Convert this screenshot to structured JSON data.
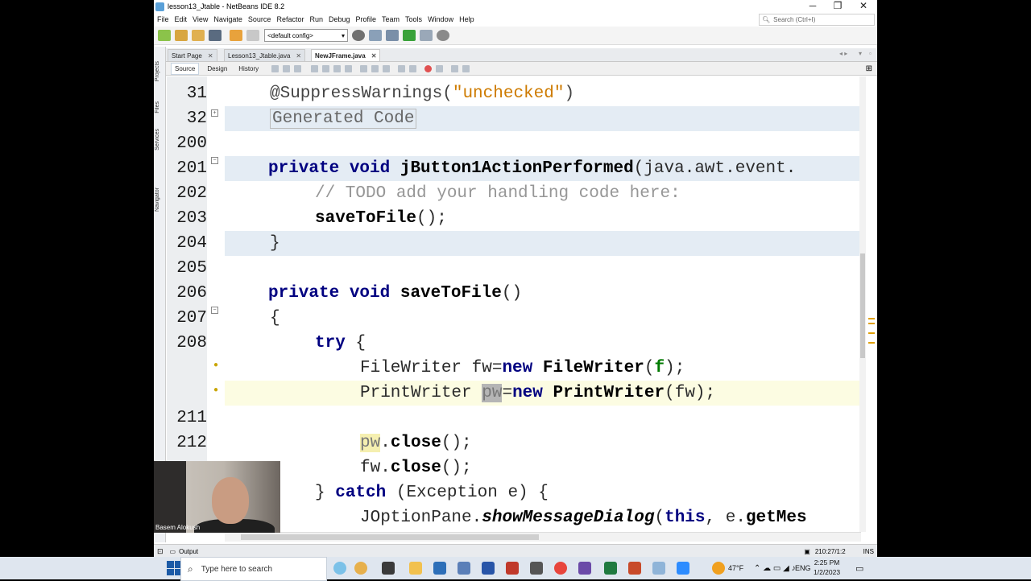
{
  "window": {
    "title": "lesson13_Jtable - NetBeans IDE 8.2",
    "controls": {
      "minimize": "─",
      "restore": "❐",
      "close": "✕"
    }
  },
  "menu": [
    "File",
    "Edit",
    "View",
    "Navigate",
    "Source",
    "Refactor",
    "Run",
    "Debug",
    "Profile",
    "Team",
    "Tools",
    "Window",
    "Help"
  ],
  "search": {
    "placeholder": "Search (Ctrl+I)"
  },
  "toolbar": {
    "config": "<default config>"
  },
  "side_panels": [
    "Projects",
    "Files",
    "Services",
    "Navigator"
  ],
  "tabs": [
    {
      "label": "Start Page",
      "active": false
    },
    {
      "label": "Lesson13_Jtable.java",
      "active": false
    },
    {
      "label": "NewJFrame.java",
      "active": true
    }
  ],
  "editor_tabs": [
    "Source",
    "Design",
    "History"
  ],
  "code_lines": [
    {
      "num": "31",
      "text": "@SuppressWarnings(\"unchecked\")"
    },
    {
      "num": "32",
      "text": "Generated Code"
    },
    {
      "num": "200",
      "text": ""
    },
    {
      "num": "201",
      "text": "private void jButton1ActionPerformed(java.awt.event."
    },
    {
      "num": "202",
      "text": "// TODO add your handling code here:"
    },
    {
      "num": "203",
      "text": "saveToFile();"
    },
    {
      "num": "204",
      "text": "}"
    },
    {
      "num": "205",
      "text": ""
    },
    {
      "num": "206",
      "text": "private void saveToFile()"
    },
    {
      "num": "207",
      "text": "{"
    },
    {
      "num": "208",
      "text": "try {"
    },
    {
      "num": "",
      "text": "FileWriter fw=new FileWriter(f);"
    },
    {
      "num": "",
      "text": "PrintWriter pw=new PrintWriter(fw);"
    },
    {
      "num": "211",
      "text": ""
    },
    {
      "num": "212",
      "text": "pw.close();"
    },
    {
      "num": "",
      "text": "fw.close();"
    },
    {
      "num": "",
      "text": "} catch (Exception e) {"
    },
    {
      "num": "",
      "text": "JOptionPane.showMessageDialog(this, e.getMes"
    }
  ],
  "output_panel": {
    "label": "Output"
  },
  "status": {
    "position": "210:27/1:2",
    "mode": "INS"
  },
  "webcam": {
    "name": "Basem Alokush"
  },
  "taskbar": {
    "search_placeholder": "Type here to search",
    "weather": "47°F",
    "language": "ENG",
    "time": "2:25 PM",
    "date": "1/2/2023"
  },
  "colors": {
    "keyword": "#000080",
    "string": "#ce7b00",
    "comment": "#969696",
    "current_line": "#fcfce2",
    "fold_highlight": "#e4ecf4"
  }
}
